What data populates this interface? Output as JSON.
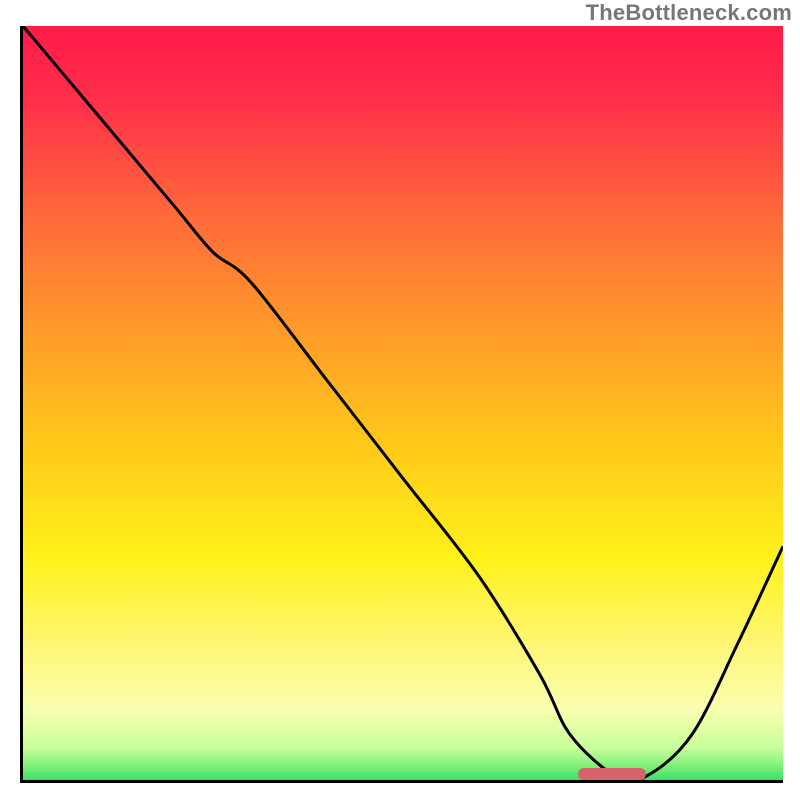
{
  "watermark": "TheBottleneck.com",
  "colors": {
    "watermark_text": "#777777",
    "axis": "#000000",
    "curve": "#000000",
    "marker": "#d9636a",
    "gradient_stops": [
      {
        "offset": 0.0,
        "color": "#ff1a4a"
      },
      {
        "offset": 0.1,
        "color": "#ff2f4a"
      },
      {
        "offset": 0.25,
        "color": "#ff6a3a"
      },
      {
        "offset": 0.4,
        "color": "#ff9a2a"
      },
      {
        "offset": 0.55,
        "color": "#ffc91a"
      },
      {
        "offset": 0.7,
        "color": "#fff11a"
      },
      {
        "offset": 0.82,
        "color": "#fff77a"
      },
      {
        "offset": 0.9,
        "color": "#f8ffb0"
      },
      {
        "offset": 0.95,
        "color": "#c8ff9a"
      },
      {
        "offset": 0.975,
        "color": "#7af07a"
      },
      {
        "offset": 1.0,
        "color": "#1ed760"
      }
    ]
  },
  "chart_data": {
    "type": "line",
    "title": "",
    "xlabel": "",
    "ylabel": "",
    "xlim": [
      0,
      100
    ],
    "ylim": [
      0,
      100
    ],
    "grid": false,
    "legend": false,
    "series": [
      {
        "name": "bottleneck-curve",
        "x": [
          0,
          10,
          20,
          25,
          30,
          40,
          50,
          60,
          68,
          72,
          78,
          82,
          88,
          94,
          100
        ],
        "values": [
          100,
          88,
          76,
          70,
          66,
          53,
          40,
          27,
          14,
          6,
          0.5,
          0.5,
          6,
          18,
          31
        ]
      }
    ],
    "annotations": [
      {
        "name": "optimal-marker",
        "type": "rounded-bar",
        "x_start": 73,
        "x_end": 82,
        "y": 0.5,
        "color": "#d9636a"
      }
    ]
  }
}
